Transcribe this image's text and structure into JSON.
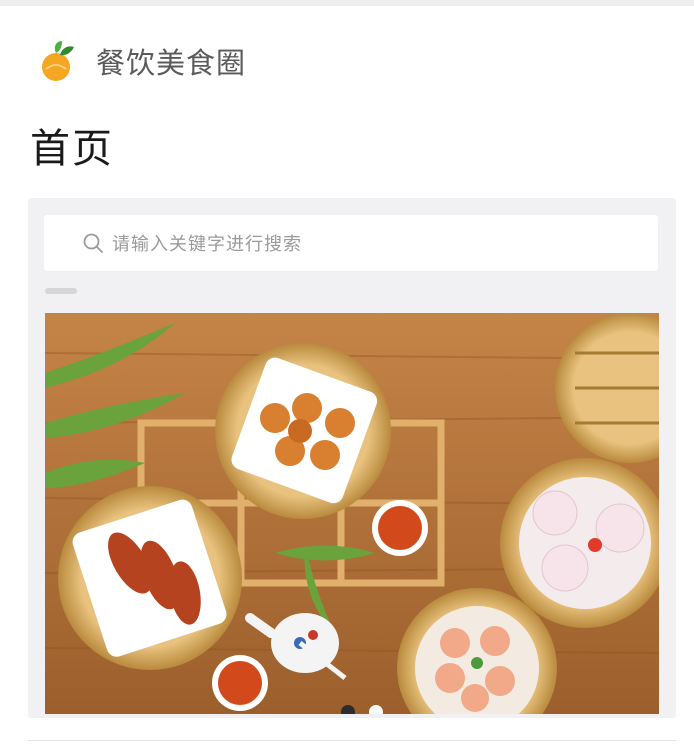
{
  "app": {
    "name": "餐饮美食圈"
  },
  "page": {
    "title": "首页"
  },
  "search": {
    "placeholder": "请输入关键字进行搜索"
  },
  "banner": {
    "slides": 2,
    "active_slide": 1
  },
  "colors": {
    "logo_orange": "#f5a623",
    "logo_green": "#4caf3f",
    "panel_bg": "#f1f1f3",
    "table_wood": "#b4733b",
    "bamboo": "#d9a85a"
  },
  "icons": {
    "search": "search-icon",
    "logo": "app-logo"
  }
}
